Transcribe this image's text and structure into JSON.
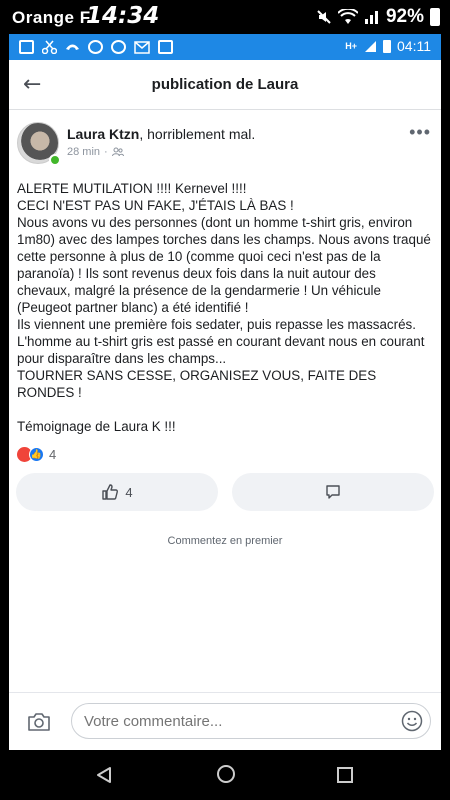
{
  "outer_status": {
    "carrier": "Orange F",
    "time": "14:34",
    "battery": "92%"
  },
  "inner_status": {
    "time": "04:11",
    "network": "H+"
  },
  "appbar": {
    "title": "publication de Laura"
  },
  "post": {
    "author": "Laura Ktzn",
    "feeling": ", horriblement mal.",
    "time_ago": "28 min",
    "privacy_icon": "friends-icon",
    "body": "ALERTE MUTILATION !!!! Kernevel !!!!\nCECI N'EST PAS UN FAKE, J'ÉTAIS LÀ BAS !\nNous avons vu des personnes (dont un homme t-shirt gris, environ 1m80) avec des lampes torches dans les champs. Nous avons traqué cette personne à plus de 10 (comme quoi ceci n'est pas de la paranoïa) ! Ils sont revenus deux fois dans la nuit autour des chevaux, malgré la présence de la gendarmerie ! Un véhicule (Peugeot partner blanc) a été identifié !\nIls viennent une première fois sedater, puis repasse les massacrés.\nL'homme au t-shirt gris est passé en courant devant nous en courant pour disparaître dans les champs...\n TOURNER SANS CESSE, ORGANISEZ VOUS, FAITE DES RONDES !\n\nTémoignage de Laura K !!!",
    "reaction_count": "4",
    "like_count": "4"
  },
  "comments": {
    "first_prompt": "Commentez en premier",
    "placeholder": "Votre commentaire..."
  },
  "colors": {
    "status_blue": "#1e88e5",
    "online_green": "#42b72a",
    "like_blue": "#1877f2",
    "angry_red": "#f0443a"
  }
}
